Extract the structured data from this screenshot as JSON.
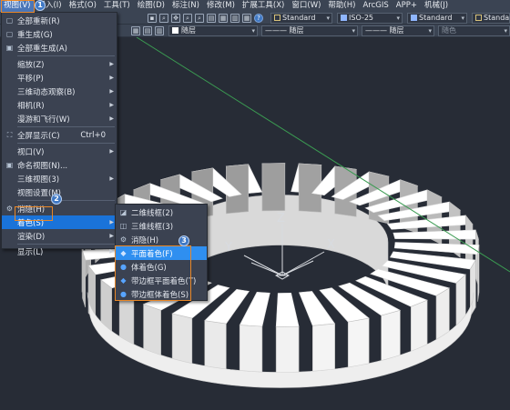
{
  "menubar": {
    "items": [
      "视图(V)",
      "插入(I)",
      "格式(O)",
      "工具(T)",
      "绘图(D)",
      "标注(N)",
      "修改(M)",
      "扩展工具(X)",
      "窗口(W)",
      "帮助(H)",
      "ArcGIS",
      "APP+",
      "机械(J)"
    ]
  },
  "toolbar": {
    "text_style": "Standard",
    "dim_style": "ISO-25",
    "table_style": "Standard",
    "multileader_style": "Standard",
    "layer_color": "随层",
    "linetype": "随层",
    "lineweight": "随层",
    "plot_style": "随色"
  },
  "view_menu": {
    "items": [
      {
        "label": "全部重新(R)",
        "icon": "redraw-icon"
      },
      {
        "label": "重生成(G)",
        "icon": "regen-icon"
      },
      {
        "label": "全部重生成(A)",
        "icon": "regen-all-icon"
      },
      {
        "label": "缩放(Z)",
        "submenu": true
      },
      {
        "label": "平移(P)",
        "submenu": true
      },
      {
        "label": "三维动态观察(B)",
        "submenu": true
      },
      {
        "label": "相机(R)",
        "submenu": true
      },
      {
        "label": "漫游和飞行(W)",
        "submenu": true
      },
      {
        "label": "全屏显示(C)",
        "shortcut": "Ctrl+0",
        "icon": "fullscreen-icon"
      },
      {
        "label": "视口(V)",
        "submenu": true
      },
      {
        "label": "命名视图(N)...",
        "icon": "named-view-icon"
      },
      {
        "label": "三维视图(3)",
        "submenu": true
      },
      {
        "label": "视图设置(M)"
      },
      {
        "label": "消隐(H)",
        "icon": "hide-icon"
      },
      {
        "label": "着色(S)",
        "submenu": true
      },
      {
        "label": "渲染(D)",
        "submenu": true
      },
      {
        "label": "显示(L)",
        "submenu": true
      }
    ]
  },
  "shade_menu": {
    "items": [
      {
        "label": "二维线框(2)",
        "icon": "2d-wireframe-icon"
      },
      {
        "label": "三维线框(3)",
        "icon": "3d-wireframe-icon"
      },
      {
        "label": "消隐(H)",
        "icon": "hidden-icon"
      },
      {
        "label": "平面着色(F)",
        "icon": "flat-shaded-icon"
      },
      {
        "label": "体着色(G)",
        "icon": "gouraud-shaded-icon"
      },
      {
        "label": "带边框平面着色(T)",
        "icon": "flat-shaded-edges-icon"
      },
      {
        "label": "带边框体着色(S)",
        "icon": "gouraud-shaded-edges-icon"
      }
    ]
  },
  "markers": {
    "step1": "1",
    "step2": "2",
    "step3": "3"
  },
  "ucs": {
    "z": "Z",
    "y": "Y",
    "x": "X"
  },
  "colors": {
    "accent": "#1a73d9",
    "marker": "#e98727",
    "background": "#272c36"
  }
}
